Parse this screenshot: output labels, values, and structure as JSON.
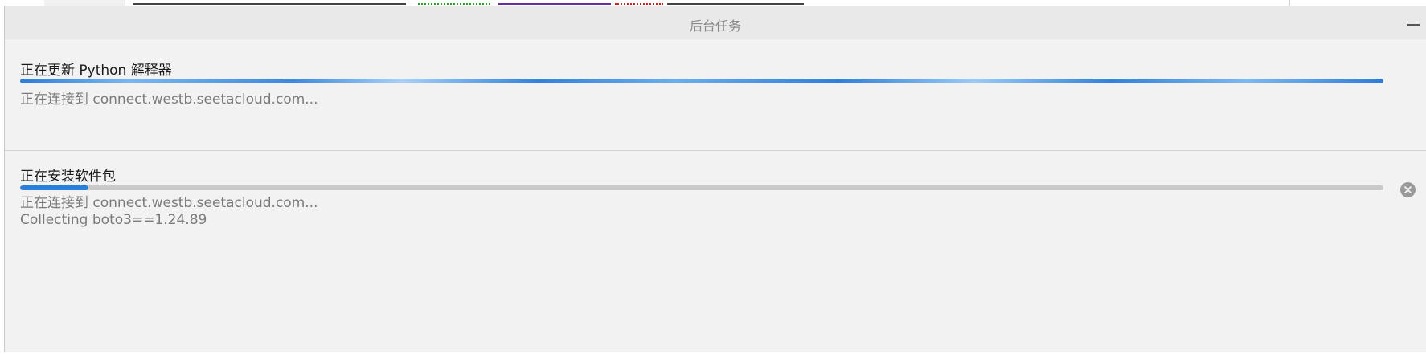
{
  "panel": {
    "title": "后台任务",
    "minimize_icon": "minimize-icon"
  },
  "tasks": [
    {
      "title": "正在更新 Python 解释器",
      "progress_mode": "indeterminate",
      "status_lines": [
        "正在连接到 connect.westb.seetacloud.com..."
      ]
    },
    {
      "title": "正在安装软件包",
      "progress_mode": "determinate",
      "progress_fraction": 0.05,
      "status_lines": [
        "正在连接到 connect.westb.seetacloud.com...",
        "Collecting boto3==1.24.89"
      ],
      "cancel_icon": "cancel-circle-icon"
    }
  ],
  "colors": {
    "progress_fill": "#2a7fdc",
    "progress_track": "#c9c9c9",
    "panel_bg": "#f2f2f2",
    "header_bg": "#e9e9e9"
  }
}
